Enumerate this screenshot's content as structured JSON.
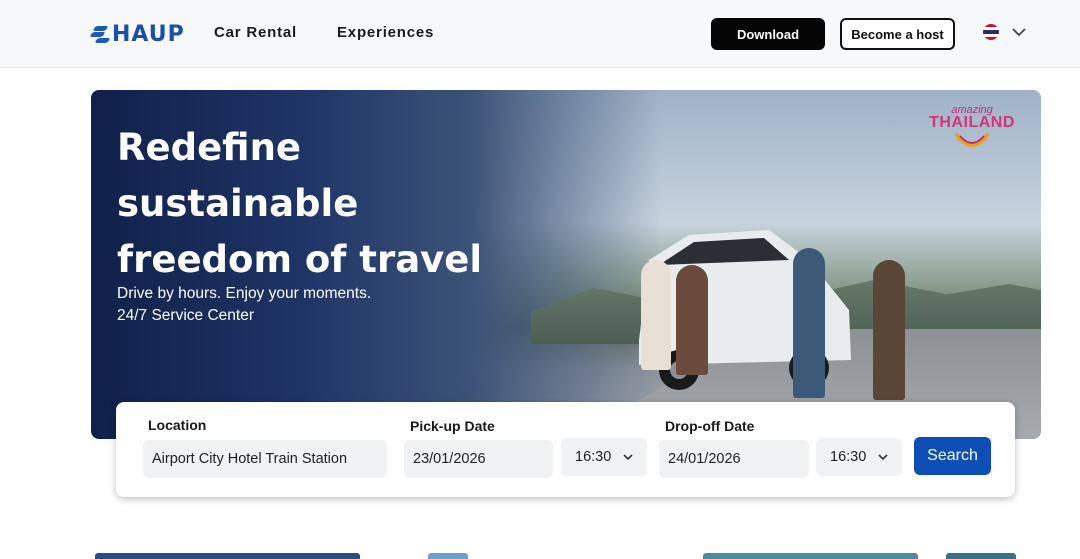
{
  "brand": {
    "name": "HAUP",
    "color": "#1e4fa8"
  },
  "nav": {
    "links": [
      "Car Rental",
      "Experiences"
    ],
    "download_label": "Download",
    "host_label": "Become a host",
    "language_flag": "thailand-flag-icon",
    "language_dropdown_icon": "chevron-down-icon"
  },
  "hero": {
    "title_lines": [
      "Redefine",
      "sustainable",
      "freedom of travel"
    ],
    "subtitle_lines": [
      "Drive by hours.  Enjoy your moments.",
      "24/7 Service Center"
    ],
    "partner_logo": {
      "small": "amazing",
      "big": "THAILAND"
    }
  },
  "search": {
    "location_label": "Location",
    "location_value": "Airport City Hotel Train Station",
    "pickup_label": "Pick-up Date",
    "pickup_date": "23/01/2026",
    "pickup_time": "16:30",
    "dropoff_label": "Drop-off Date",
    "dropoff_date": "24/01/2026",
    "dropoff_time": "16:30",
    "search_label": "Search",
    "accent_color": "#0d4fb5"
  }
}
